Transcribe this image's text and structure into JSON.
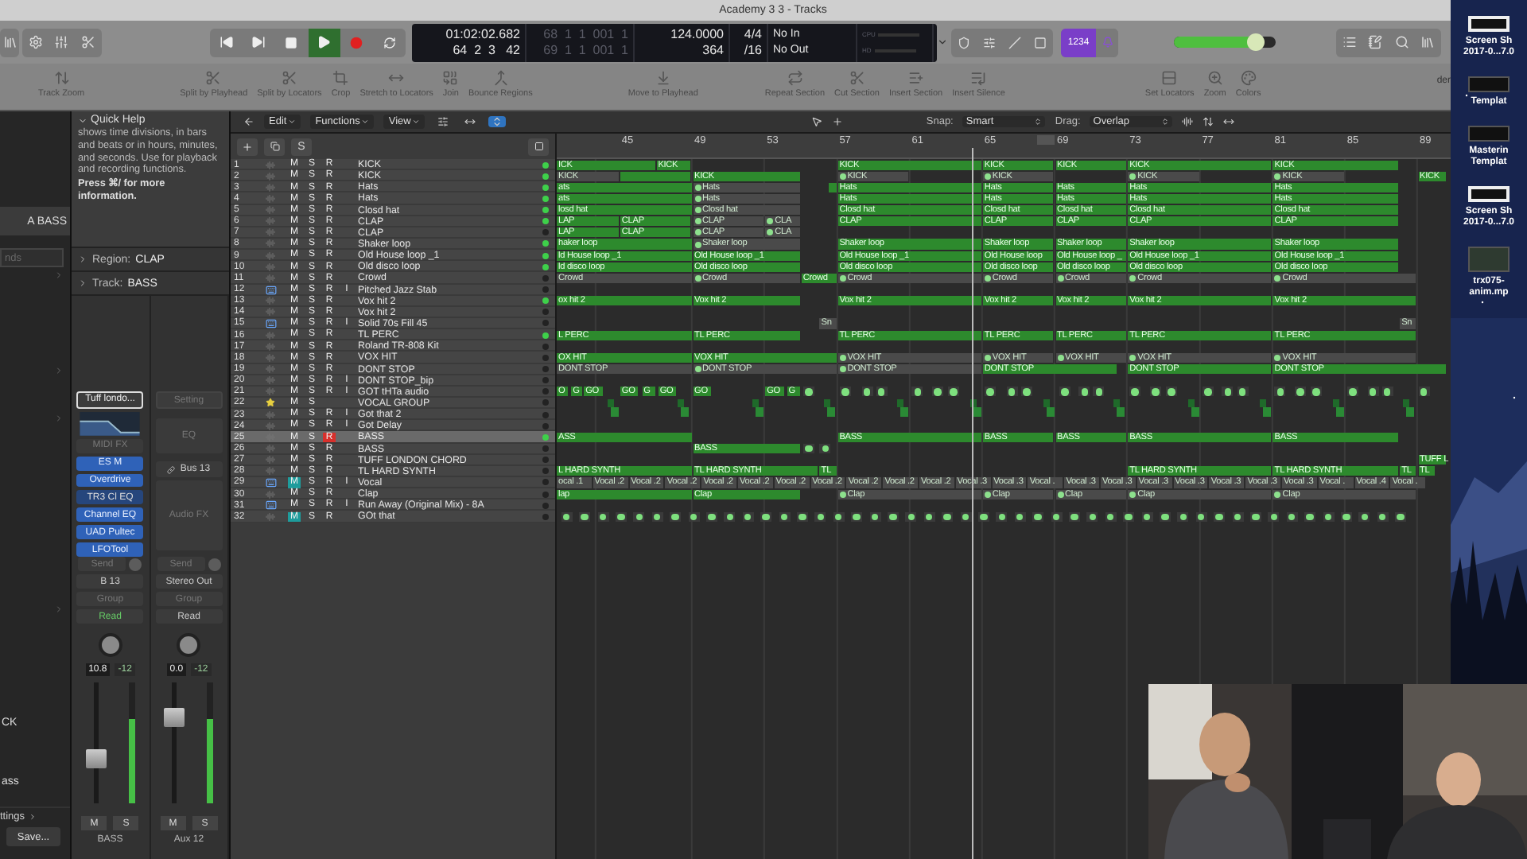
{
  "window": {
    "title": "Academy 3 3 - Tracks"
  },
  "control_bar": {
    "transport": [
      {
        "kind": "rewind",
        "on": false
      },
      {
        "kind": "forward",
        "on": false
      },
      {
        "kind": "stop",
        "on": false
      },
      {
        "kind": "play",
        "on": true
      },
      {
        "kind": "record",
        "on": false
      },
      {
        "kind": "cycle",
        "on": false
      }
    ],
    "lcd": {
      "time": "01:02:02.682",
      "position": "64  2  3   42",
      "locator_start": "68  1  1  001  1",
      "locator_end": "69  1  1  001  1",
      "tempo": "124.0000",
      "tempo_sub": "364",
      "signature": "4/4",
      "division": "/16",
      "input": "No In",
      "output": "No Out",
      "cpu": "CPU",
      "hd": "HD"
    },
    "count_in": {
      "label": "1234",
      "on": true
    },
    "metronome_on": true,
    "master_volume": {
      "level": 0.8
    },
    "side_text": "der"
  },
  "toolbar": [
    [
      "Track Zoom"
    ],
    [
      "Split by Playhead",
      "Split by Locators",
      "Crop",
      "Stretch to Locators",
      "Join",
      "Bounce Regions"
    ],
    [
      "Move to Playhead"
    ],
    [
      "Repeat Section",
      "Cut Section",
      "Insert Section",
      "Insert Silence"
    ],
    [
      "Set Locators",
      "Zoom",
      "Colors"
    ]
  ],
  "library": {
    "selected": "A BASS",
    "search_placeholder": "nds",
    "items": [
      "CK",
      "ass"
    ],
    "settings": "ttings",
    "save": "Save..."
  },
  "inspector": {
    "quick_help": {
      "title": "Quick Help",
      "text": "shows time divisions, in bars and beats or in hours, minutes, and seconds. Use for playback and recording functions.",
      "tip": "Press ⌘/ for more information."
    },
    "region": {
      "label": "Region:",
      "value": "CLAP"
    },
    "track": {
      "label": "Track:",
      "value": "BASS"
    },
    "strips": [
      {
        "slots": [
          {
            "kind": "setting",
            "label": "Tuff londo...",
            "selected": true
          },
          {
            "kind": "eq-graph"
          },
          {
            "kind": "label",
            "label": "MIDI FX"
          },
          {
            "kind": "plugin",
            "label": "ES M"
          },
          {
            "kind": "plugin",
            "label": "Overdrive"
          },
          {
            "kind": "plugin-off",
            "label": "TR3 Cl EQ"
          },
          {
            "kind": "plugin",
            "label": "Channel EQ"
          },
          {
            "kind": "plugin",
            "label": "UAD Pultec"
          },
          {
            "kind": "plugin",
            "label": "LFOTool"
          }
        ],
        "send": "Send",
        "output": "B 13",
        "group": "Group",
        "automation": "Read",
        "volume": "10.8",
        "peak": "-12",
        "fader": {
          "level": 0.35
        },
        "meter": {
          "level": 0.7
        },
        "mute": "M",
        "solo": "S",
        "name": "BASS"
      },
      {
        "slots": [
          {
            "kind": "setting",
            "label": "Setting",
            "selected": false
          },
          {
            "kind": "eq-box",
            "label": "EQ"
          },
          {
            "kind": "input",
            "label": "Bus 13"
          },
          {
            "kind": "fx-box",
            "label": "Audio FX"
          }
        ],
        "send": "Send",
        "output": "Stereo Out",
        "group": "Group",
        "automation": "Read",
        "volume": "0.0",
        "peak": "-12",
        "fader": {
          "level": 0.75
        },
        "meter": {
          "level": 0.7
        },
        "mute": "M",
        "solo": "S",
        "name": "Aux 12"
      }
    ]
  },
  "arrange_menu": {
    "menus": [
      "Edit",
      "Functions",
      "View"
    ],
    "snap_label": "Snap:",
    "snap": "Smart",
    "drag_label": "Drag:",
    "drag": "Overlap"
  },
  "track_header": {
    "global_solo": "S"
  },
  "ruler": [
    "45",
    "49",
    "53",
    "57",
    "61",
    "65",
    "69",
    "73",
    "77",
    "81",
    "85",
    "89"
  ],
  "tracks": [
    {
      "number": "1",
      "name": "KICK",
      "kind": "audio",
      "active": true,
      "selected": false,
      "mute": "M",
      "mute_on": false,
      "solo": "S",
      "rec": "R",
      "rec_on": false,
      "regions": [
        {
          "label": "ICK",
          "kind": "audio"
        },
        {
          "label": "KICK",
          "kind": "audio"
        },
        {
          "label": "KICK",
          "kind": "audio"
        },
        {
          "label": "KICK",
          "kind": "audio"
        },
        {
          "label": "KICK",
          "kind": "audio"
        },
        {
          "label": "KICK",
          "kind": "audio"
        },
        {
          "label": "KICK",
          "kind": "audio"
        }
      ]
    },
    {
      "number": "2",
      "name": "KICK",
      "kind": "audio",
      "active": true,
      "selected": false,
      "mute": "M",
      "mute_on": false,
      "solo": "S",
      "rec": "R",
      "rec_on": false,
      "regions": [
        {
          "label": "KICK",
          "kind": "grey"
        },
        {
          "kind": "audio"
        },
        {
          "label": "KICK",
          "kind": "audio"
        },
        {
          "label": "KICK",
          "kind": "alias"
        },
        {
          "label": "KICK",
          "kind": "alias"
        },
        {
          "label": "KICK",
          "kind": "alias"
        },
        {
          "label": "KICK",
          "kind": "alias"
        },
        {
          "label": "KICK",
          "kind": "audio"
        }
      ]
    },
    {
      "number": "3",
      "name": "Hats",
      "kind": "audio",
      "active": true,
      "selected": false,
      "mute": "M",
      "mute_on": false,
      "solo": "S",
      "rec": "R",
      "rec_on": false,
      "regions": [
        {
          "label": "ats",
          "kind": "audio"
        },
        {
          "label": "Hats",
          "kind": "alias"
        },
        {
          "kind": "audio"
        },
        {
          "label": "Hats",
          "kind": "audio"
        },
        {
          "label": "Hats",
          "kind": "audio"
        },
        {
          "label": "Hats",
          "kind": "audio"
        },
        {
          "label": "Hats",
          "kind": "audio"
        },
        {
          "label": "Hats",
          "kind": "audio"
        }
      ]
    },
    {
      "number": "4",
      "name": "Hats",
      "kind": "audio",
      "active": true,
      "selected": false,
      "mute": "M",
      "mute_on": false,
      "solo": "S",
      "rec": "R",
      "rec_on": false,
      "regions": [
        {
          "label": "ats",
          "kind": "audio"
        },
        {
          "label": "Hats",
          "kind": "alias"
        },
        {
          "label": "Hats",
          "kind": "audio"
        },
        {
          "label": "Hats",
          "kind": "audio"
        },
        {
          "label": "Hats",
          "kind": "audio"
        },
        {
          "label": "Hats",
          "kind": "audio"
        },
        {
          "label": "Hats",
          "kind": "audio"
        }
      ]
    },
    {
      "number": "5",
      "name": "Closd hat",
      "kind": "audio",
      "active": true,
      "selected": false,
      "mute": "M",
      "mute_on": false,
      "solo": "S",
      "rec": "R",
      "rec_on": false,
      "regions": [
        {
          "label": "losd hat",
          "kind": "audio"
        },
        {
          "label": "Closd hat",
          "kind": "alias"
        },
        {
          "label": "Closd hat",
          "kind": "audio"
        },
        {
          "label": "Closd hat",
          "kind": "audio"
        },
        {
          "label": "Closd hat",
          "kind": "audio"
        },
        {
          "label": "Closd hat",
          "kind": "audio"
        },
        {
          "label": "Closd hat",
          "kind": "audio"
        }
      ]
    },
    {
      "number": "6",
      "name": "CLAP",
      "kind": "audio",
      "active": true,
      "selected": false,
      "mute": "M",
      "mute_on": false,
      "solo": "S",
      "rec": "R",
      "rec_on": false,
      "regions": [
        {
          "label": "LAP",
          "kind": "audio"
        },
        {
          "label": "CLAP",
          "kind": "audio"
        },
        {
          "label": "CLAP",
          "kind": "alias"
        },
        {
          "label": "CLA",
          "kind": "alias"
        },
        {
          "label": "CLAP",
          "kind": "audio"
        },
        {
          "label": "CLAP",
          "kind": "audio"
        },
        {
          "label": "CLAP",
          "kind": "audio"
        },
        {
          "label": "CLAP",
          "kind": "audio"
        },
        {
          "label": "CLAP",
          "kind": "audio"
        }
      ]
    },
    {
      "number": "7",
      "name": "CLAP",
      "kind": "audio",
      "active": false,
      "selected": false,
      "mute": "M",
      "mute_on": false,
      "solo": "S",
      "rec": "R",
      "rec_on": false,
      "regions": [
        {
          "label": "LAP",
          "kind": "audio"
        },
        {
          "label": "CLAP",
          "kind": "audio"
        },
        {
          "label": "CLAP",
          "kind": "alias"
        },
        {
          "label": "CLA",
          "kind": "alias"
        }
      ]
    },
    {
      "number": "8",
      "name": "Shaker loop",
      "kind": "audio",
      "active": true,
      "selected": false,
      "mute": "M",
      "mute_on": false,
      "solo": "S",
      "rec": "R",
      "rec_on": false,
      "regions": [
        {
          "label": "haker loop",
          "kind": "audio"
        },
        {
          "label": "Shaker loop",
          "kind": "alias"
        },
        {
          "label": "Shaker loop",
          "kind": "audio"
        },
        {
          "label": "Shaker loop",
          "kind": "audio"
        },
        {
          "label": "Shaker loop",
          "kind": "audio"
        },
        {
          "label": "Shaker loop",
          "kind": "audio"
        },
        {
          "label": "Shaker loop",
          "kind": "audio"
        }
      ]
    },
    {
      "number": "9",
      "name": "Old House loop _1",
      "kind": "audio",
      "active": true,
      "selected": false,
      "mute": "M",
      "mute_on": false,
      "solo": "S",
      "rec": "R",
      "rec_on": false,
      "regions": [
        {
          "label": "ld House loop _1",
          "kind": "audio"
        },
        {
          "label": "Old House loop _1",
          "kind": "audio"
        },
        {
          "label": "Old House loop _1",
          "kind": "audio"
        },
        {
          "label": "Old House loop",
          "kind": "audio"
        },
        {
          "label": "Old House loop _",
          "kind": "audio"
        },
        {
          "label": "Old House loop _1",
          "kind": "audio"
        },
        {
          "label": "Old House loop _1",
          "kind": "audio"
        }
      ]
    },
    {
      "number": "10",
      "name": "Old disco  loop",
      "kind": "audio",
      "active": true,
      "selected": false,
      "mute": "M",
      "mute_on": false,
      "solo": "S",
      "rec": "R",
      "rec_on": false,
      "regions": [
        {
          "label": "ld disco  loop",
          "kind": "audio"
        },
        {
          "label": "Old disco  loop",
          "kind": "audio"
        },
        {
          "label": "Old disco  loop",
          "kind": "audio"
        },
        {
          "label": "Old disco  loop",
          "kind": "audio"
        },
        {
          "label": "Old disco  loop",
          "kind": "audio"
        },
        {
          "label": "Old disco  loop",
          "kind": "audio"
        },
        {
          "label": "Old disco  loop",
          "kind": "audio"
        }
      ]
    },
    {
      "number": "11",
      "name": "Crowd",
      "kind": "audio",
      "active": false,
      "selected": false,
      "mute": "M",
      "mute_on": false,
      "solo": "S",
      "rec": "R",
      "rec_on": false,
      "regions": [
        {
          "label": "Crowd",
          "kind": "grey"
        },
        {
          "label": "Crowd",
          "kind": "alias"
        },
        {
          "label": "Crowd",
          "kind": "audio"
        },
        {
          "label": "Crowd",
          "kind": "alias"
        },
        {
          "label": "Crowd",
          "kind": "alias"
        },
        {
          "label": "Crowd",
          "kind": "alias"
        },
        {
          "label": "Crowd",
          "kind": "alias"
        },
        {
          "label": "Crowd",
          "kind": "alias"
        }
      ]
    },
    {
      "number": "12",
      "name": "Pitched Jazz Stab",
      "kind": "instrument",
      "active": false,
      "selected": false,
      "mute": "M",
      "mute_on": false,
      "solo": "S",
      "rec": "R",
      "rec_on": false,
      "input": "I"
    },
    {
      "number": "13",
      "name": "Vox hit 2",
      "kind": "audio",
      "active": true,
      "selected": false,
      "mute": "M",
      "mute_on": false,
      "solo": "S",
      "rec": "R",
      "rec_on": false,
      "regions": [
        {
          "label": "ox hit 2",
          "kind": "audio"
        },
        {
          "label": "Vox hit 2",
          "kind": "audio"
        },
        {
          "label": "Vox hit 2",
          "kind": "audio"
        },
        {
          "label": "Vox hit 2",
          "kind": "audio"
        },
        {
          "label": "Vox hit 2",
          "kind": "audio"
        },
        {
          "label": "Vox hit 2",
          "kind": "audio"
        },
        {
          "label": "Vox hit 2",
          "kind": "audio"
        }
      ]
    },
    {
      "number": "14",
      "name": "Vox hit 2",
      "kind": "audio",
      "active": false,
      "selected": false,
      "mute": "M",
      "mute_on": false,
      "solo": "S",
      "rec": "R",
      "rec_on": false
    },
    {
      "number": "15",
      "name": "Solid 70s Fill 45",
      "kind": "instrument",
      "active": false,
      "selected": false,
      "mute": "M",
      "mute_on": false,
      "solo": "S",
      "rec": "R",
      "rec_on": false,
      "input": "I",
      "regions": [
        {
          "label": "Sn",
          "kind": "grey"
        },
        {
          "label": "Sn",
          "kind": "grey"
        }
      ]
    },
    {
      "number": "16",
      "name": "TL PERC",
      "kind": "audio",
      "active": true,
      "selected": false,
      "mute": "M",
      "mute_on": false,
      "solo": "S",
      "rec": "R",
      "rec_on": false,
      "regions": [
        {
          "label": "L PERC",
          "kind": "audio"
        },
        {
          "label": "TL PERC",
          "kind": "audio"
        },
        {
          "label": "TL PERC",
          "kind": "audio"
        },
        {
          "label": "TL PERC",
          "kind": "audio"
        },
        {
          "label": "TL PERC",
          "kind": "audio"
        },
        {
          "label": "TL PERC",
          "kind": "audio"
        },
        {
          "label": "TL PERC",
          "kind": "audio"
        }
      ]
    },
    {
      "number": "17",
      "name": "Roland TR-808 Kit",
      "kind": "audio",
      "active": false,
      "selected": false,
      "mute": "M",
      "mute_on": false,
      "solo": "S",
      "rec": "R",
      "rec_on": false
    },
    {
      "number": "18",
      "name": "VOX HIT",
      "kind": "audio",
      "active": false,
      "selected": false,
      "mute": "M",
      "mute_on": false,
      "solo": "S",
      "rec": "R",
      "rec_on": false,
      "regions": [
        {
          "label": "OX HIT",
          "kind": "audio"
        },
        {
          "label": "VOX HIT",
          "kind": "audio"
        },
        {
          "label": "VOX HIT",
          "kind": "alias"
        },
        {
          "label": "VOX HIT",
          "kind": "alias"
        },
        {
          "label": "VOX HIT",
          "kind": "alias"
        },
        {
          "label": "VOX HIT",
          "kind": "alias"
        },
        {
          "label": "VOX HIT",
          "kind": "alias"
        }
      ]
    },
    {
      "number": "19",
      "name": "DONT STOP",
      "kind": "audio",
      "active": false,
      "selected": false,
      "mute": "M",
      "mute_on": false,
      "solo": "S",
      "rec": "R",
      "rec_on": false,
      "regions": [
        {
          "label": "DONT STOP",
          "kind": "grey"
        },
        {
          "label": "DONT STOP",
          "kind": "alias"
        },
        {
          "label": "DONT STOP",
          "kind": "alias"
        },
        {
          "label": "DONT STOP",
          "kind": "audio"
        },
        {
          "label": "DONT STOP",
          "kind": "audio"
        },
        {
          "label": "DONT STOP",
          "kind": "audio"
        }
      ]
    },
    {
      "number": "20",
      "name": "DONT STOP_bip",
      "kind": "audio",
      "active": false,
      "selected": false,
      "mute": "M",
      "mute_on": false,
      "solo": "S",
      "rec": "R",
      "rec_on": false,
      "input": "I"
    },
    {
      "number": "21",
      "name": "GOT tHTa audio",
      "kind": "audio",
      "active": false,
      "selected": false,
      "mute": "M",
      "mute_on": false,
      "solo": "S",
      "rec": "R",
      "rec_on": false,
      "input": "I",
      "regions": [
        {
          "label": "O",
          "kind": "audio"
        },
        {
          "label": "G",
          "kind": "audio"
        },
        {
          "label": "GO",
          "kind": "audio"
        },
        {
          "label": "GO",
          "kind": "audio"
        },
        {
          "label": "G",
          "kind": "audio"
        },
        {
          "label": "GO",
          "kind": "audio"
        },
        {
          "label": "GO",
          "kind": "audio"
        },
        {
          "label": "GO",
          "kind": "audio"
        },
        {
          "label": "G",
          "kind": "audio"
        },
        {
          "kind": "dot"
        },
        {
          "kind": "dot"
        },
        {
          "kind": "dot"
        },
        {
          "kind": "dot"
        },
        {
          "kind": "dot"
        },
        {
          "kind": "dot"
        },
        {
          "kind": "dot"
        },
        {
          "kind": "dot"
        },
        {
          "kind": "dot"
        },
        {
          "kind": "dot"
        },
        {
          "kind": "dot"
        },
        {
          "kind": "dot"
        },
        {
          "kind": "dot"
        },
        {
          "kind": "dot"
        },
        {
          "kind": "dot"
        },
        {
          "kind": "dot"
        },
        {
          "kind": "dot"
        },
        {
          "kind": "dot"
        },
        {
          "kind": "dot"
        },
        {
          "kind": "dot"
        },
        {
          "kind": "dot"
        },
        {
          "kind": "dot"
        },
        {
          "kind": "dot"
        },
        {
          "kind": "dot"
        },
        {
          "kind": "dot"
        },
        {
          "kind": "dot"
        }
      ]
    },
    {
      "number": "22",
      "name": "VOCAL GROUP",
      "kind": "group",
      "active": false,
      "selected": false,
      "mute": "M",
      "mute_on": false,
      "solo": "S",
      "regions": [
        {
          "kind": "notes"
        },
        {
          "kind": "notes"
        },
        {
          "kind": "notes"
        },
        {
          "kind": "notes"
        },
        {
          "kind": "notes"
        },
        {
          "kind": "notes"
        },
        {
          "kind": "notes"
        },
        {
          "kind": "notes"
        },
        {
          "kind": "notes"
        },
        {
          "kind": "notes"
        },
        {
          "kind": "notes"
        },
        {
          "kind": "notes"
        }
      ]
    },
    {
      "number": "23",
      "name": "Got that 2",
      "kind": "audio",
      "active": false,
      "selected": false,
      "mute": "M",
      "mute_on": false,
      "solo": "S",
      "rec": "R",
      "rec_on": false,
      "input": "I"
    },
    {
      "number": "24",
      "name": "Got Delay",
      "kind": "audio",
      "active": false,
      "selected": false,
      "mute": "M",
      "mute_on": false,
      "solo": "S",
      "rec": "R",
      "rec_on": false,
      "input": "I"
    },
    {
      "number": "25",
      "name": "BASS",
      "kind": "audio",
      "active": true,
      "selected": true,
      "mute": "M",
      "mute_on": false,
      "solo": "S",
      "rec": "R",
      "rec_on": true,
      "regions": [
        {
          "label": "ASS",
          "kind": "audio"
        },
        {
          "label": "BASS",
          "kind": "audio"
        },
        {
          "label": "BASS",
          "kind": "audio"
        },
        {
          "label": "BASS",
          "kind": "audio"
        },
        {
          "label": "BASS",
          "kind": "audio"
        },
        {
          "label": "BASS",
          "kind": "audio"
        }
      ]
    },
    {
      "number": "26",
      "name": "BASS",
      "kind": "audio",
      "active": false,
      "selected": false,
      "mute": "M",
      "mute_on": false,
      "solo": "S",
      "rec": "R",
      "rec_on": false,
      "regions": [
        {
          "label": "BASS",
          "kind": "audio"
        },
        {
          "kind": "dot"
        },
        {
          "kind": "dot"
        }
      ]
    },
    {
      "number": "27",
      "name": "TUFF LONDON CHORD",
      "kind": "audio",
      "active": false,
      "selected": false,
      "mute": "M",
      "mute_on": false,
      "solo": "S",
      "rec": "R",
      "rec_on": false,
      "regions": [
        {
          "label": "TUFF L",
          "kind": "audio"
        }
      ]
    },
    {
      "number": "28",
      "name": "TL HARD SYNTH",
      "kind": "audio",
      "active": false,
      "selected": false,
      "mute": "M",
      "mute_on": false,
      "solo": "S",
      "rec": "R",
      "rec_on": false,
      "regions": [
        {
          "label": "L HARD SYNTH",
          "kind": "audio"
        },
        {
          "label": "TL HARD SYNTH",
          "kind": "audio"
        },
        {
          "label": "TL",
          "kind": "audio"
        },
        {
          "label": "TL HARD SYNTH",
          "kind": "audio"
        },
        {
          "label": "TL HARD SYNTH",
          "kind": "audio"
        },
        {
          "label": "TL",
          "kind": "audio"
        },
        {
          "label": "TL",
          "kind": "audio"
        }
      ]
    },
    {
      "number": "29",
      "name": "Vocal",
      "kind": "instrument",
      "active": false,
      "selected": false,
      "mute": "M",
      "mute_on": true,
      "solo": "S",
      "rec": "R",
      "rec_on": false,
      "input": "I",
      "regions": [
        {
          "label": "ocal .1",
          "kind": "grey"
        },
        {
          "label": "Vocal .2",
          "kind": "grey"
        },
        {
          "label": "Vocal .2",
          "kind": "grey"
        },
        {
          "label": "Vocal .2",
          "kind": "grey"
        },
        {
          "label": "Vocal .2",
          "kind": "grey"
        },
        {
          "label": "Vocal .2",
          "kind": "grey"
        },
        {
          "label": "Vocal .2",
          "kind": "grey"
        },
        {
          "label": "Vocal .2",
          "kind": "grey"
        },
        {
          "label": "Vocal .2",
          "kind": "grey"
        },
        {
          "label": "Vocal .2",
          "kind": "grey"
        },
        {
          "label": "Vocal .2",
          "kind": "grey"
        },
        {
          "label": "Vocal .3",
          "kind": "grey"
        },
        {
          "label": "Vocal .3",
          "kind": "grey"
        },
        {
          "label": "Vocal .",
          "kind": "grey"
        },
        {
          "label": "Vocal .3",
          "kind": "grey"
        },
        {
          "label": "Vocal .3",
          "kind": "grey"
        },
        {
          "label": "Vocal .3",
          "kind": "grey"
        },
        {
          "label": "Vocal .3",
          "kind": "grey"
        },
        {
          "label": "Vocal .3",
          "kind": "grey"
        },
        {
          "label": "Vocal .3",
          "kind": "grey"
        },
        {
          "label": "Vocal .3",
          "kind": "grey"
        },
        {
          "label": "Vocal .",
          "kind": "grey"
        },
        {
          "label": "Vocal .4",
          "kind": "grey"
        },
        {
          "label": "Vocal .",
          "kind": "grey"
        }
      ]
    },
    {
      "number": "30",
      "name": "Clap",
      "kind": "audio",
      "active": false,
      "selected": false,
      "mute": "M",
      "mute_on": false,
      "solo": "S",
      "rec": "R",
      "rec_on": false,
      "regions": [
        {
          "label": "lap",
          "kind": "audio"
        },
        {
          "label": "Clap",
          "kind": "audio"
        },
        {
          "label": "Clap",
          "kind": "alias"
        },
        {
          "label": "Clap",
          "kind": "alias"
        },
        {
          "label": "Clap",
          "kind": "alias"
        },
        {
          "label": "Clap",
          "kind": "alias"
        },
        {
          "label": "Clap",
          "kind": "alias"
        }
      ]
    },
    {
      "number": "31",
      "name": "Run Away (Original Mix) - 8A",
      "kind": "instrument",
      "active": false,
      "selected": false,
      "mute": "M",
      "mute_on": false,
      "solo": "S",
      "rec": "R",
      "rec_on": false,
      "input": "I"
    },
    {
      "number": "32",
      "name": "GOt that",
      "kind": "audio",
      "active": false,
      "selected": false,
      "mute": "M",
      "mute_on": true,
      "solo": "S",
      "rec": "R",
      "rec_on": false,
      "regions": [
        {
          "kind": "dots"
        }
      ]
    }
  ],
  "desktop": {
    "icons": [
      {
        "kind": "screenshot",
        "lines": [
          "Screen Sh",
          "2017-0...7.0"
        ]
      },
      {
        "kind": "template",
        "lines": [
          "Templat"
        ]
      },
      {
        "kind": "template",
        "lines": [
          "Masterin",
          "Templat"
        ]
      },
      {
        "kind": "screenshot",
        "lines": [
          "Screen Sh",
          "2017-0...7.0"
        ]
      },
      {
        "kind": "video",
        "lines": [
          "trx075-",
          "anim.mp"
        ]
      }
    ]
  },
  "webcam": {
    "kind": "picture"
  }
}
